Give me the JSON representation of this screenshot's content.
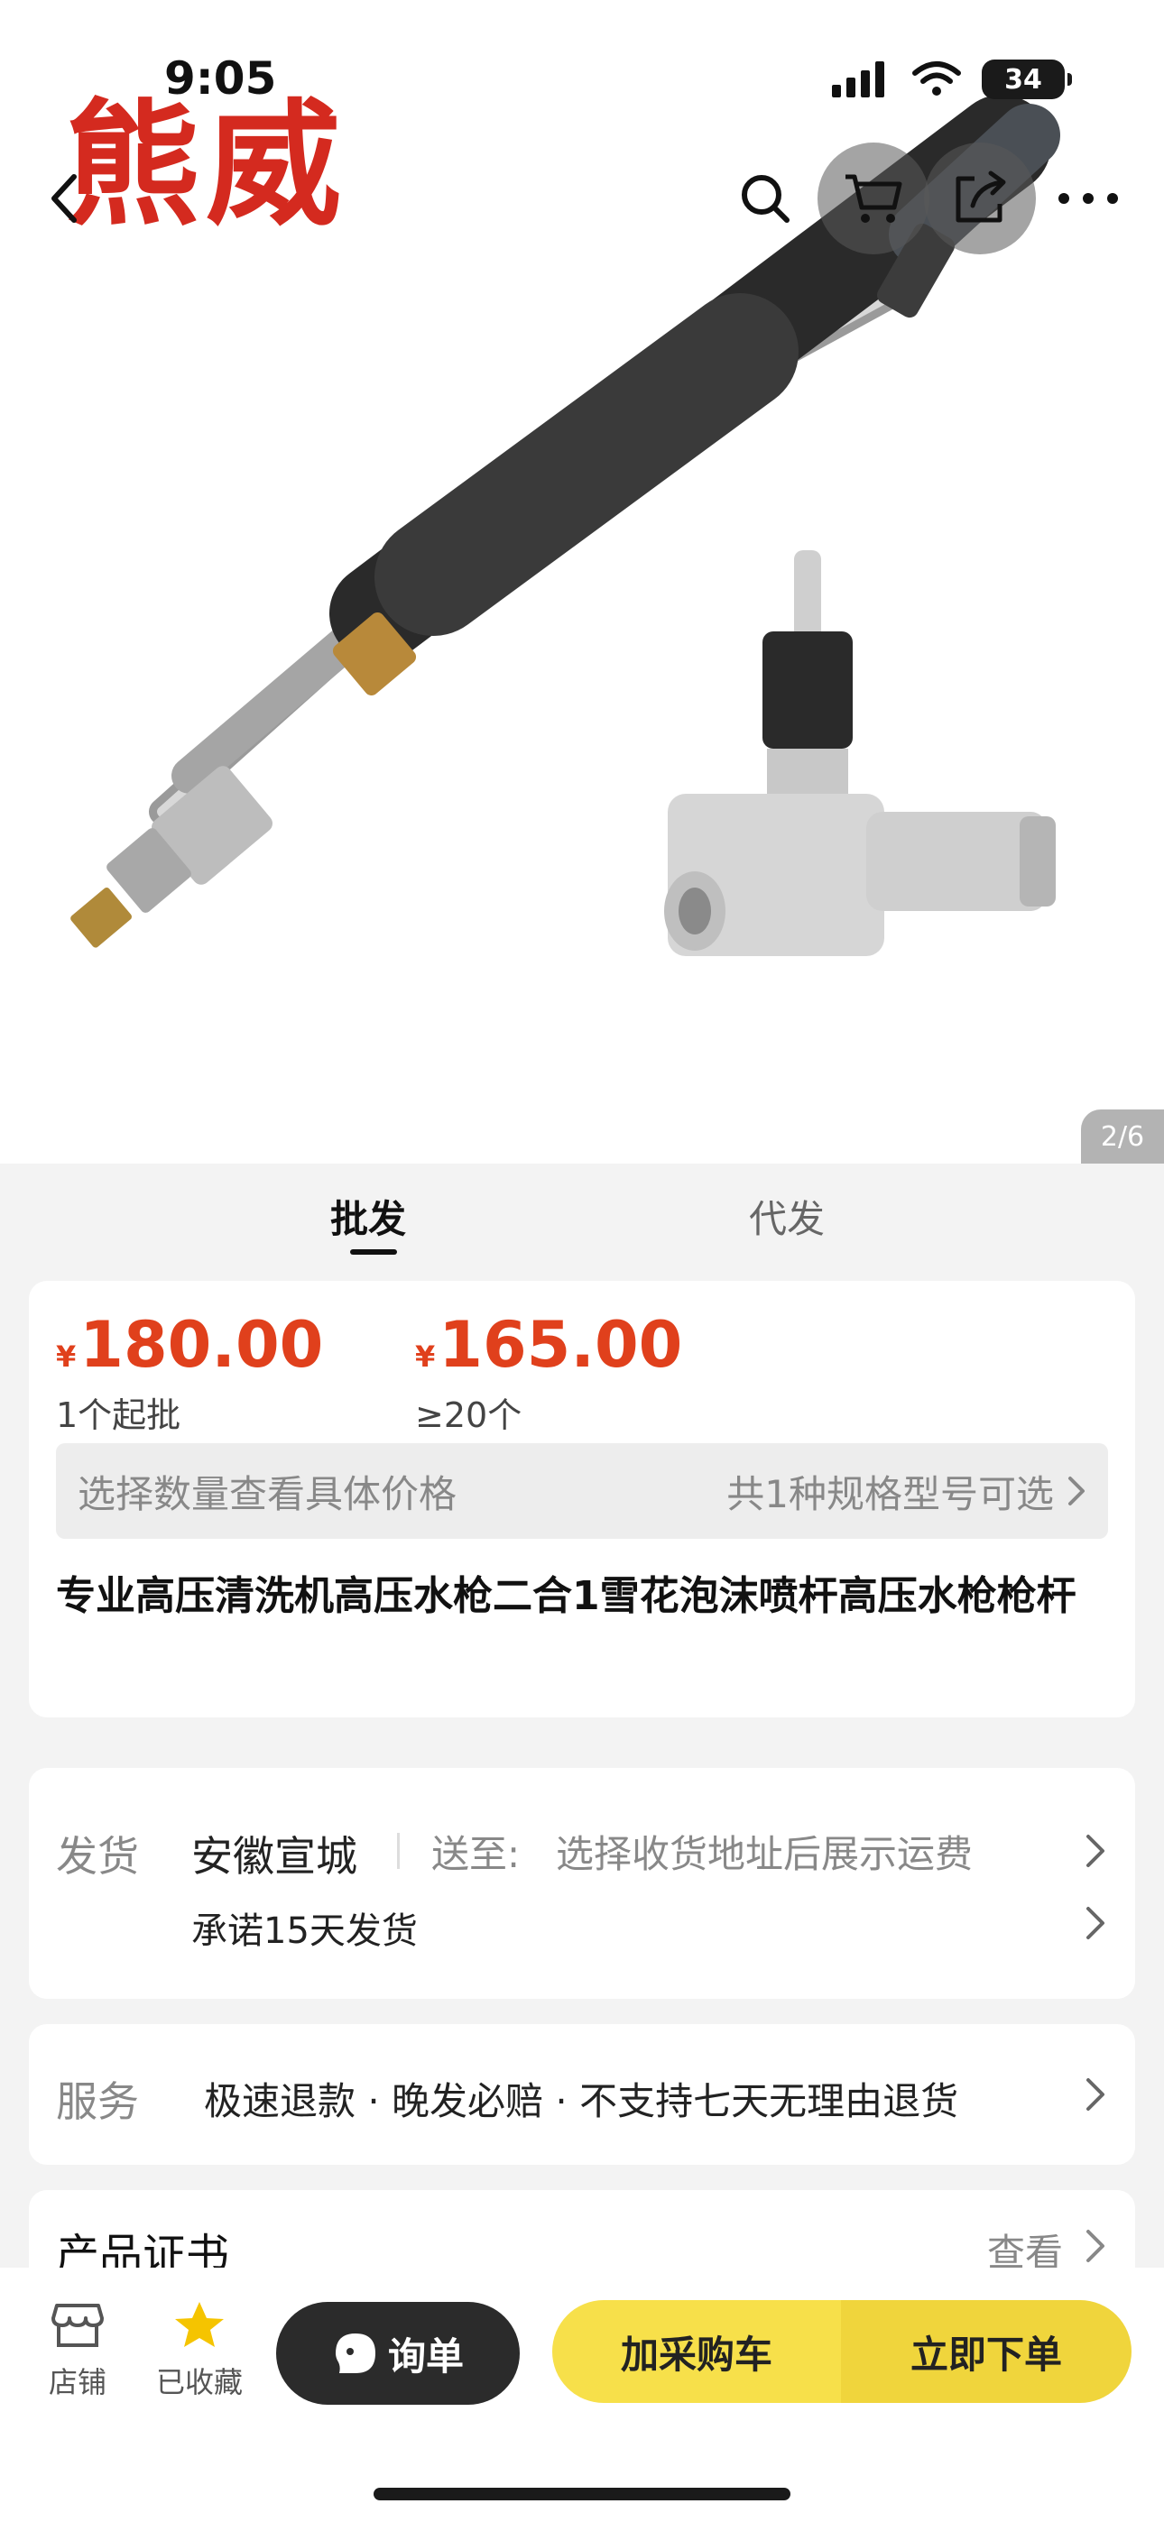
{
  "status_bar": {
    "time": "9:05",
    "battery": "34"
  },
  "hero": {
    "brand_watermark": "熊威",
    "pager": "2/6"
  },
  "tabs": [
    {
      "label": "批发"
    },
    {
      "label": "代发"
    }
  ],
  "pricing": {
    "tiers": [
      {
        "currency": "¥",
        "price": "180.00",
        "note": "1个起批"
      },
      {
        "currency": "¥",
        "price": "165.00",
        "note": "≥20个"
      }
    ],
    "spec_prompt": "选择数量查看具体价格",
    "spec_count": "共1种规格型号可选"
  },
  "product": {
    "title": "专业高压清洗机高压水枪二合1雪花泡沫喷杆高压水枪枪杆"
  },
  "shipping": {
    "label": "发货",
    "origin": "安徽宣城",
    "to_label": "送至:",
    "to_value": "选择收货地址后展示运费",
    "promise": "承诺15天发货"
  },
  "service": {
    "label": "服务",
    "items": "极速退款 · 晚发必赔 · 不支持七天无理由退货"
  },
  "certificate": {
    "label": "产品证书",
    "action": "查看"
  },
  "bottom_bar": {
    "store": "店铺",
    "favorited": "已收藏",
    "inquiry": "询单",
    "add_cart": "加采购车",
    "buy_now": "立即下单"
  },
  "colors": {
    "price": "#e0401c",
    "cart_button": "#f7e04a",
    "buy_button": "#f0d53c",
    "favorite_star": "#f5c400"
  }
}
